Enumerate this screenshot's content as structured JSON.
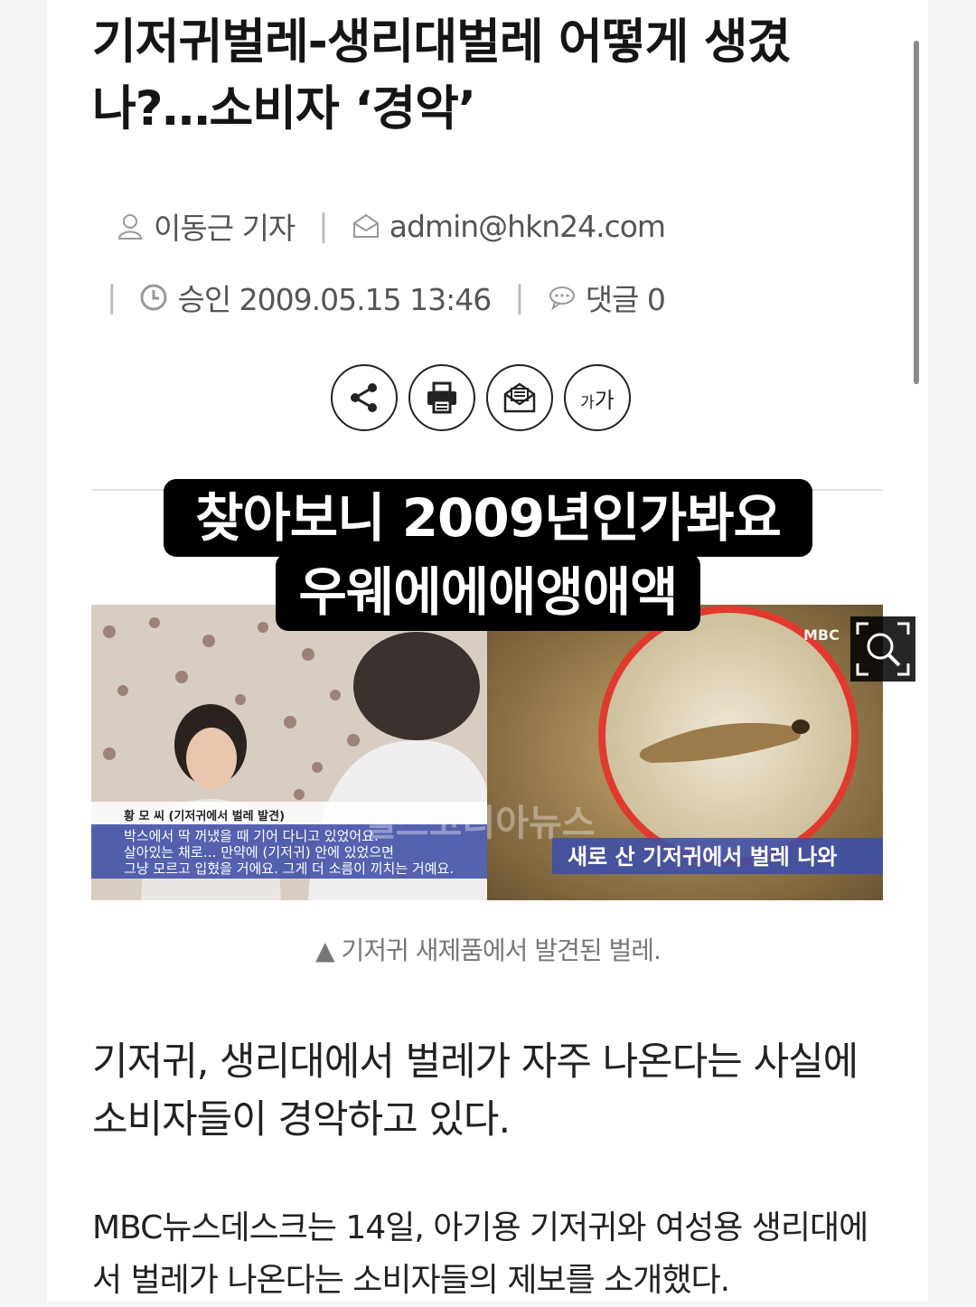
{
  "article": {
    "headline": "기저귀벌레-생리대벌레 어떻게 생겼나?…소비자 ‘경악’",
    "author": "이동근 기자",
    "email": "admin@hkn24.com",
    "approved": "승인 2009.05.15 13:46",
    "comments": "댓글 0",
    "font_size_big": "가",
    "font_size_small": "가"
  },
  "photo": {
    "left_title": "황 모 씨 (기저귀에서 벌레 발견)",
    "left_line1": "박스에서 딱 꺼냈을 때 기어 다니고 있었어요.",
    "left_line2": "살아있는 채로… 만약에 (기저귀) 안에 있었으면",
    "left_line3": "그냥 모르고 입혔을 거에요. 그게 더 소름이 끼치는 거예요.",
    "watermark": "헬스코리아뉴스",
    "right_caption": "새로 산 기저귀에서 벌레 나와",
    "logo": "MBC"
  },
  "overlay": {
    "line1": "찾아보니 2009년인가봐요",
    "line2": "우웨에에애앵애액"
  },
  "caption": "▲ 기저귀 새제품에서 발견된 벌레.",
  "body": {
    "p1": "기저귀, 생리대에서 벌레가 자주 나온다는 사실에 소비자들이 경악하고 있다.",
    "p2": "MBC뉴스데스크는 14일, 아기용 기저귀와 여성용 생리대에서 벌레가 나온다는 소비자들의 제보를 소개했다."
  }
}
